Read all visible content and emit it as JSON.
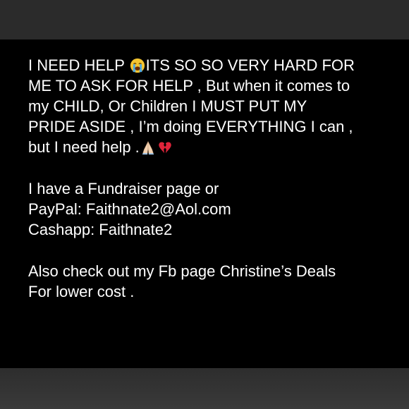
{
  "post": {
    "paragraph1": {
      "line1_a": "I NEED HELP ",
      "line1_b": "ITS SO SO VERY HARD FOR",
      "line2": "ME TO ASK FOR HELP , But when it comes to",
      "line3": "my CHILD, Or Children I MUST PUT MY",
      "line4": "PRIDE ASIDE , I’m doing EVERYTHING I can ,",
      "line5": "but I need help ."
    },
    "paragraph2": {
      "line1": "I have a Fundraiser page or",
      "line2": "PayPal: Faithnate2@Aol.com",
      "line3": "Cashapp: Faithnate2"
    },
    "paragraph3": {
      "line1": "Also check out my Fb page Christine’s Deals",
      "line2": "For lower cost ."
    },
    "icons": {
      "crying": "loudly-crying-face-icon",
      "pray": "folded-hands-icon",
      "broken_heart": "broken-heart-icon"
    }
  }
}
